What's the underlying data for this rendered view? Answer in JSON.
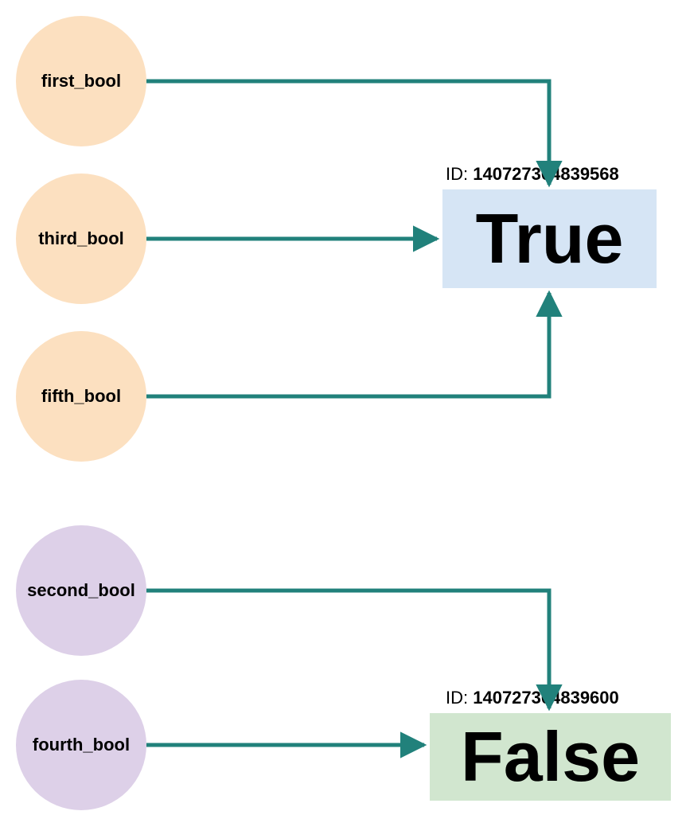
{
  "nodes": {
    "first": {
      "label": "first_bool",
      "group": "true"
    },
    "third": {
      "label": "third_bool",
      "group": "true"
    },
    "fifth": {
      "label": "fifth_bool",
      "group": "true"
    },
    "second": {
      "label": "second_bool",
      "group": "false"
    },
    "fourth": {
      "label": "fourth_bool",
      "group": "false"
    }
  },
  "targets": {
    "true": {
      "label": "True",
      "id_prefix": "ID: ",
      "id_value": "140727304839568"
    },
    "false": {
      "label": "False",
      "id_prefix": "ID: ",
      "id_value": "140727304839600"
    }
  },
  "colors": {
    "arrow": "#21817b"
  }
}
